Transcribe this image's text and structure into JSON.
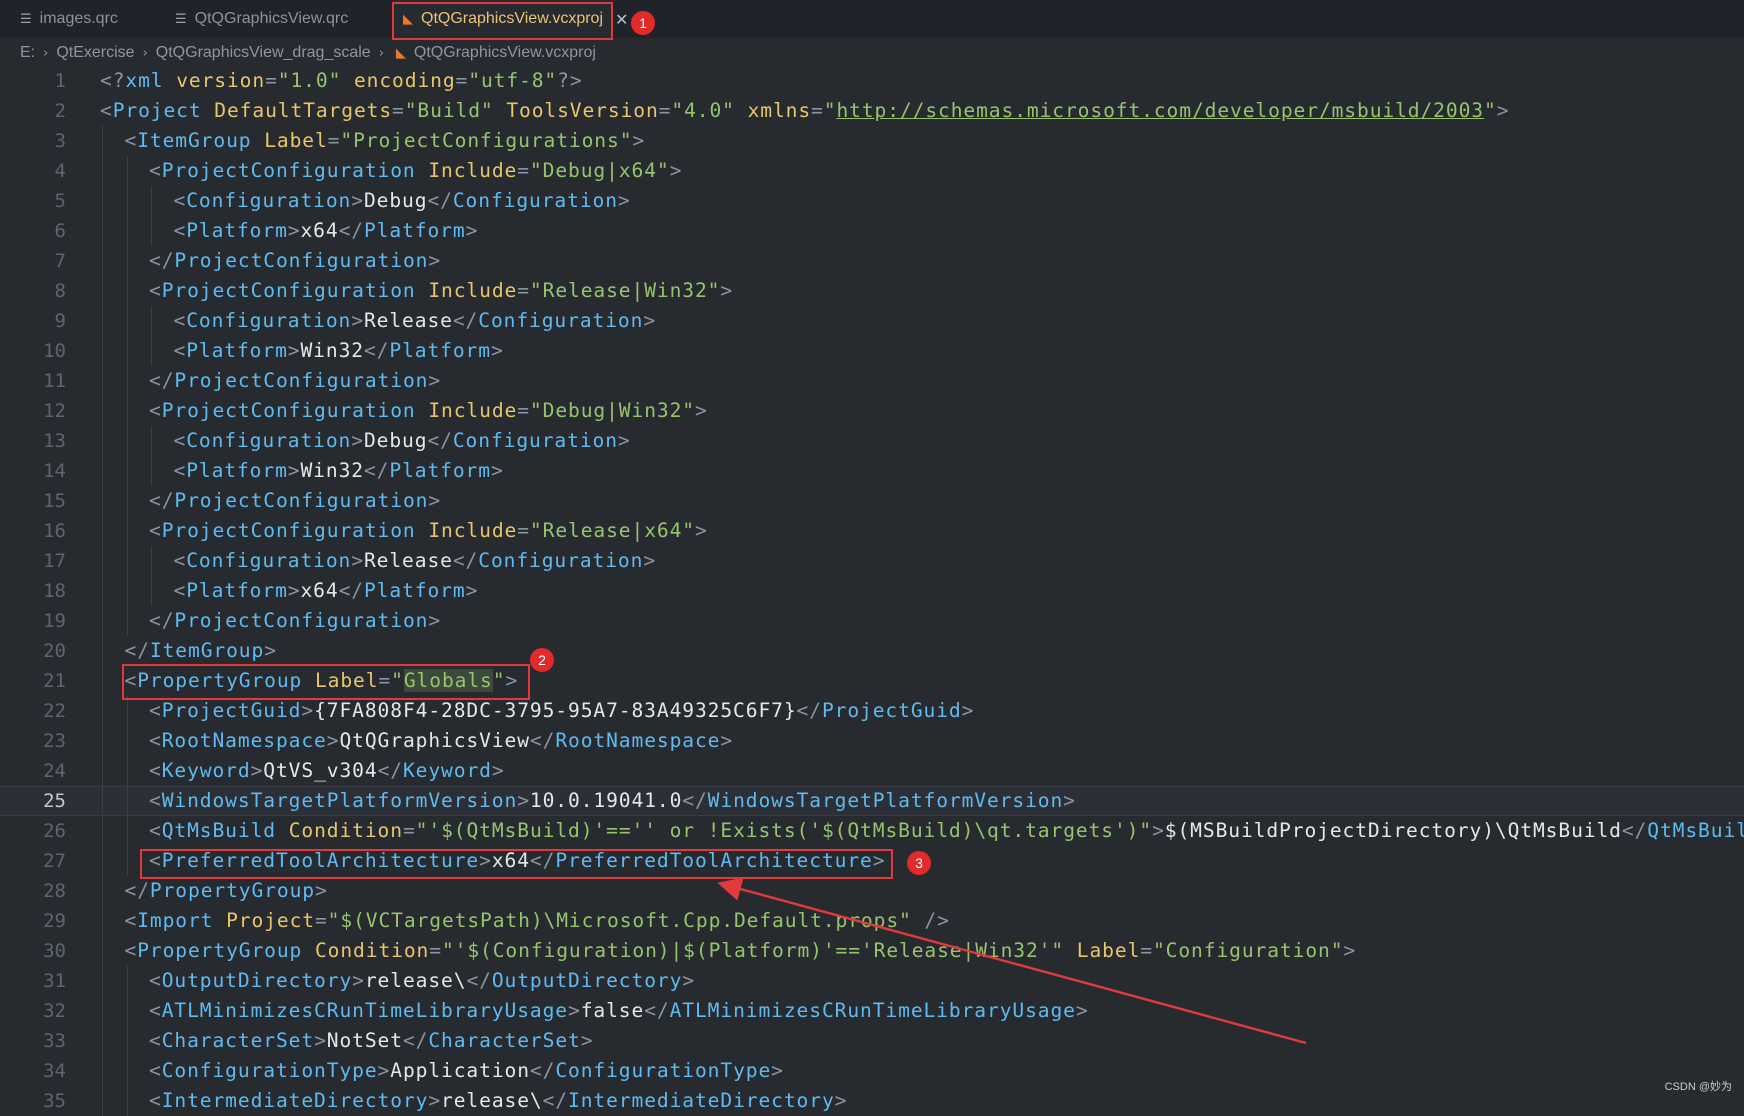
{
  "tabs": [
    {
      "label": "images.qrc",
      "icon": "file-lines-icon"
    },
    {
      "label": "QtQGraphicsView.qrc",
      "icon": "file-lines-icon"
    },
    {
      "label": "QtQGraphicsView.vcxproj",
      "icon": "rss-icon",
      "active": true
    }
  ],
  "breadcrumb": [
    "E:",
    "QtExercise",
    "QtQGraphicsView_drag_scale",
    "QtQGraphicsView.vcxproj"
  ],
  "current_line": 25,
  "lines": [
    {
      "n": "1",
      "indent": 0,
      "tokens": [
        [
          "p",
          "<?"
        ],
        [
          "tag",
          "xml"
        ],
        [
          "t",
          " "
        ],
        [
          "attr",
          "version"
        ],
        [
          "p",
          "="
        ],
        [
          "str",
          "\"1.0\""
        ],
        [
          "t",
          " "
        ],
        [
          "attr",
          "encoding"
        ],
        [
          "p",
          "="
        ],
        [
          "str",
          "\"utf-8\""
        ],
        [
          "p",
          "?>"
        ]
      ]
    },
    {
      "n": "2",
      "indent": 0,
      "tokens": [
        [
          "p",
          "<"
        ],
        [
          "tag",
          "Project"
        ],
        [
          "t",
          " "
        ],
        [
          "attr",
          "DefaultTargets"
        ],
        [
          "p",
          "="
        ],
        [
          "str",
          "\"Build\""
        ],
        [
          "t",
          " "
        ],
        [
          "attr",
          "ToolsVersion"
        ],
        [
          "p",
          "="
        ],
        [
          "str",
          "\"4.0\""
        ],
        [
          "t",
          " "
        ],
        [
          "attr",
          "xmlns"
        ],
        [
          "p",
          "="
        ],
        [
          "str",
          "\""
        ],
        [
          "url",
          "http://schemas.microsoft.com/developer/msbuild/2003"
        ],
        [
          "str",
          "\""
        ],
        [
          "p",
          ">"
        ]
      ]
    },
    {
      "n": "3",
      "indent": 1,
      "tokens": [
        [
          "p",
          "<"
        ],
        [
          "tag",
          "ItemGroup"
        ],
        [
          "t",
          " "
        ],
        [
          "attr",
          "Label"
        ],
        [
          "p",
          "="
        ],
        [
          "str",
          "\"ProjectConfigurations\""
        ],
        [
          "p",
          ">"
        ]
      ]
    },
    {
      "n": "4",
      "indent": 2,
      "tokens": [
        [
          "p",
          "<"
        ],
        [
          "tag",
          "ProjectConfiguration"
        ],
        [
          "t",
          " "
        ],
        [
          "attr",
          "Include"
        ],
        [
          "p",
          "="
        ],
        [
          "str",
          "\"Debug|x64\""
        ],
        [
          "p",
          ">"
        ]
      ]
    },
    {
      "n": "5",
      "indent": 3,
      "tokens": [
        [
          "p",
          "<"
        ],
        [
          "tag",
          "Configuration"
        ],
        [
          "p",
          ">"
        ],
        [
          "txt",
          "Debug"
        ],
        [
          "p",
          "</"
        ],
        [
          "tag",
          "Configuration"
        ],
        [
          "p",
          ">"
        ]
      ]
    },
    {
      "n": "6",
      "indent": 3,
      "tokens": [
        [
          "p",
          "<"
        ],
        [
          "tag",
          "Platform"
        ],
        [
          "p",
          ">"
        ],
        [
          "txt",
          "x64"
        ],
        [
          "p",
          "</"
        ],
        [
          "tag",
          "Platform"
        ],
        [
          "p",
          ">"
        ]
      ]
    },
    {
      "n": "7",
      "indent": 2,
      "tokens": [
        [
          "p",
          "</"
        ],
        [
          "tag",
          "ProjectConfiguration"
        ],
        [
          "p",
          ">"
        ]
      ]
    },
    {
      "n": "8",
      "indent": 2,
      "tokens": [
        [
          "p",
          "<"
        ],
        [
          "tag",
          "ProjectConfiguration"
        ],
        [
          "t",
          " "
        ],
        [
          "attr",
          "Include"
        ],
        [
          "p",
          "="
        ],
        [
          "str",
          "\"Release|Win32\""
        ],
        [
          "p",
          ">"
        ]
      ]
    },
    {
      "n": "9",
      "indent": 3,
      "tokens": [
        [
          "p",
          "<"
        ],
        [
          "tag",
          "Configuration"
        ],
        [
          "p",
          ">"
        ],
        [
          "txt",
          "Release"
        ],
        [
          "p",
          "</"
        ],
        [
          "tag",
          "Configuration"
        ],
        [
          "p",
          ">"
        ]
      ]
    },
    {
      "n": "10",
      "indent": 3,
      "tokens": [
        [
          "p",
          "<"
        ],
        [
          "tag",
          "Platform"
        ],
        [
          "p",
          ">"
        ],
        [
          "txt",
          "Win32"
        ],
        [
          "p",
          "</"
        ],
        [
          "tag",
          "Platform"
        ],
        [
          "p",
          ">"
        ]
      ]
    },
    {
      "n": "11",
      "indent": 2,
      "tokens": [
        [
          "p",
          "</"
        ],
        [
          "tag",
          "ProjectConfiguration"
        ],
        [
          "p",
          ">"
        ]
      ]
    },
    {
      "n": "12",
      "indent": 2,
      "tokens": [
        [
          "p",
          "<"
        ],
        [
          "tag",
          "ProjectConfiguration"
        ],
        [
          "t",
          " "
        ],
        [
          "attr",
          "Include"
        ],
        [
          "p",
          "="
        ],
        [
          "str",
          "\"Debug|Win32\""
        ],
        [
          "p",
          ">"
        ]
      ]
    },
    {
      "n": "13",
      "indent": 3,
      "tokens": [
        [
          "p",
          "<"
        ],
        [
          "tag",
          "Configuration"
        ],
        [
          "p",
          ">"
        ],
        [
          "txt",
          "Debug"
        ],
        [
          "p",
          "</"
        ],
        [
          "tag",
          "Configuration"
        ],
        [
          "p",
          ">"
        ]
      ]
    },
    {
      "n": "14",
      "indent": 3,
      "tokens": [
        [
          "p",
          "<"
        ],
        [
          "tag",
          "Platform"
        ],
        [
          "p",
          ">"
        ],
        [
          "txt",
          "Win32"
        ],
        [
          "p",
          "</"
        ],
        [
          "tag",
          "Platform"
        ],
        [
          "p",
          ">"
        ]
      ]
    },
    {
      "n": "15",
      "indent": 2,
      "tokens": [
        [
          "p",
          "</"
        ],
        [
          "tag",
          "ProjectConfiguration"
        ],
        [
          "p",
          ">"
        ]
      ]
    },
    {
      "n": "16",
      "indent": 2,
      "tokens": [
        [
          "p",
          "<"
        ],
        [
          "tag",
          "ProjectConfiguration"
        ],
        [
          "t",
          " "
        ],
        [
          "attr",
          "Include"
        ],
        [
          "p",
          "="
        ],
        [
          "str",
          "\"Release|x64\""
        ],
        [
          "p",
          ">"
        ]
      ]
    },
    {
      "n": "17",
      "indent": 3,
      "tokens": [
        [
          "p",
          "<"
        ],
        [
          "tag",
          "Configuration"
        ],
        [
          "p",
          ">"
        ],
        [
          "txt",
          "Release"
        ],
        [
          "p",
          "</"
        ],
        [
          "tag",
          "Configuration"
        ],
        [
          "p",
          ">"
        ]
      ]
    },
    {
      "n": "18",
      "indent": 3,
      "tokens": [
        [
          "p",
          "<"
        ],
        [
          "tag",
          "Platform"
        ],
        [
          "p",
          ">"
        ],
        [
          "txt",
          "x64"
        ],
        [
          "p",
          "</"
        ],
        [
          "tag",
          "Platform"
        ],
        [
          "p",
          ">"
        ]
      ]
    },
    {
      "n": "19",
      "indent": 2,
      "tokens": [
        [
          "p",
          "</"
        ],
        [
          "tag",
          "ProjectConfiguration"
        ],
        [
          "p",
          ">"
        ]
      ]
    },
    {
      "n": "20",
      "indent": 1,
      "tokens": [
        [
          "p",
          "</"
        ],
        [
          "tag",
          "ItemGroup"
        ],
        [
          "p",
          ">"
        ]
      ]
    },
    {
      "n": "21",
      "indent": 1,
      "tokens": [
        [
          "p",
          "<"
        ],
        [
          "tag",
          "PropertyGroup"
        ],
        [
          "t",
          " "
        ],
        [
          "attr",
          "Label"
        ],
        [
          "p",
          "="
        ],
        [
          "str",
          "\""
        ],
        [
          "strh",
          "Globals"
        ],
        [
          "str",
          "\""
        ],
        [
          "p",
          ">"
        ]
      ]
    },
    {
      "n": "22",
      "indent": 2,
      "tokens": [
        [
          "p",
          "<"
        ],
        [
          "tag",
          "ProjectGuid"
        ],
        [
          "p",
          ">"
        ],
        [
          "txt",
          "{7FA808F4-28DC-3795-95A7-83A49325C6F7}"
        ],
        [
          "p",
          "</"
        ],
        [
          "tag",
          "ProjectGuid"
        ],
        [
          "p",
          ">"
        ]
      ]
    },
    {
      "n": "23",
      "indent": 2,
      "tokens": [
        [
          "p",
          "<"
        ],
        [
          "tag",
          "RootNamespace"
        ],
        [
          "p",
          ">"
        ],
        [
          "txt",
          "QtQGraphicsView"
        ],
        [
          "p",
          "</"
        ],
        [
          "tag",
          "RootNamespace"
        ],
        [
          "p",
          ">"
        ]
      ]
    },
    {
      "n": "24",
      "indent": 2,
      "tokens": [
        [
          "p",
          "<"
        ],
        [
          "tag",
          "Keyword"
        ],
        [
          "p",
          ">"
        ],
        [
          "txt",
          "QtVS_v304"
        ],
        [
          "p",
          "</"
        ],
        [
          "tag",
          "Keyword"
        ],
        [
          "p",
          ">"
        ]
      ]
    },
    {
      "n": "25",
      "indent": 2,
      "tokens": [
        [
          "p",
          "<"
        ],
        [
          "tag",
          "WindowsTargetPlatformVersion"
        ],
        [
          "p",
          ">"
        ],
        [
          "txt",
          "10.0.19041.0"
        ],
        [
          "p",
          "</"
        ],
        [
          "tag",
          "WindowsTargetPlatformVersion"
        ],
        [
          "p",
          ">"
        ]
      ]
    },
    {
      "n": "26",
      "indent": 2,
      "tokens": [
        [
          "p",
          "<"
        ],
        [
          "tag",
          "QtMsBuild"
        ],
        [
          "t",
          " "
        ],
        [
          "attr",
          "Condition"
        ],
        [
          "p",
          "="
        ],
        [
          "str",
          "\"'$(QtMsBuild)'=='' or !Exists('$(QtMsBuild)\\qt.targets')\""
        ],
        [
          "p",
          ">"
        ],
        [
          "txt",
          "$(MSBuildProjectDirectory)\\QtMsBuild"
        ],
        [
          "p",
          "</"
        ],
        [
          "tag",
          "QtMsBuild"
        ],
        [
          "p",
          ">"
        ]
      ]
    },
    {
      "n": "27",
      "indent": 2,
      "tokens": [
        [
          "p",
          "<"
        ],
        [
          "tag",
          "PreferredToolArchitecture"
        ],
        [
          "p",
          ">"
        ],
        [
          "txt",
          "x64"
        ],
        [
          "p",
          "</"
        ],
        [
          "tag",
          "PreferredToolArchitecture"
        ],
        [
          "p",
          ">"
        ]
      ]
    },
    {
      "n": "28",
      "indent": 1,
      "tokens": [
        [
          "p",
          "</"
        ],
        [
          "tag",
          "PropertyGroup"
        ],
        [
          "p",
          ">"
        ]
      ]
    },
    {
      "n": "29",
      "indent": 1,
      "tokens": [
        [
          "p",
          "<"
        ],
        [
          "tag",
          "Import"
        ],
        [
          "t",
          " "
        ],
        [
          "attr",
          "Project"
        ],
        [
          "p",
          "="
        ],
        [
          "str",
          "\"$(VCTargetsPath)\\Microsoft.Cpp.Default.props\""
        ],
        [
          "t",
          " "
        ],
        [
          "p",
          "/>"
        ]
      ]
    },
    {
      "n": "30",
      "indent": 1,
      "tokens": [
        [
          "p",
          "<"
        ],
        [
          "tag",
          "PropertyGroup"
        ],
        [
          "t",
          " "
        ],
        [
          "attr",
          "Condition"
        ],
        [
          "p",
          "="
        ],
        [
          "str",
          "\"'$(Configuration)|$(Platform)'=='Release|Win32'\""
        ],
        [
          "t",
          " "
        ],
        [
          "attr",
          "Label"
        ],
        [
          "p",
          "="
        ],
        [
          "str",
          "\"Configuration\""
        ],
        [
          "p",
          ">"
        ]
      ]
    },
    {
      "n": "31",
      "indent": 2,
      "tokens": [
        [
          "p",
          "<"
        ],
        [
          "tag",
          "OutputDirectory"
        ],
        [
          "p",
          ">"
        ],
        [
          "txt",
          "release\\"
        ],
        [
          "p",
          "</"
        ],
        [
          "tag",
          "OutputDirectory"
        ],
        [
          "p",
          ">"
        ]
      ]
    },
    {
      "n": "32",
      "indent": 2,
      "tokens": [
        [
          "p",
          "<"
        ],
        [
          "tag",
          "ATLMinimizesCRunTimeLibraryUsage"
        ],
        [
          "p",
          ">"
        ],
        [
          "txt",
          "false"
        ],
        [
          "p",
          "</"
        ],
        [
          "tag",
          "ATLMinimizesCRunTimeLibraryUsage"
        ],
        [
          "p",
          ">"
        ]
      ]
    },
    {
      "n": "33",
      "indent": 2,
      "tokens": [
        [
          "p",
          "<"
        ],
        [
          "tag",
          "CharacterSet"
        ],
        [
          "p",
          ">"
        ],
        [
          "txt",
          "NotSet"
        ],
        [
          "p",
          "</"
        ],
        [
          "tag",
          "CharacterSet"
        ],
        [
          "p",
          ">"
        ]
      ]
    },
    {
      "n": "34",
      "indent": 2,
      "tokens": [
        [
          "p",
          "<"
        ],
        [
          "tag",
          "ConfigurationType"
        ],
        [
          "p",
          ">"
        ],
        [
          "txt",
          "Application"
        ],
        [
          "p",
          "</"
        ],
        [
          "tag",
          "ConfigurationType"
        ],
        [
          "p",
          ">"
        ]
      ]
    },
    {
      "n": "35",
      "indent": 2,
      "tokens": [
        [
          "p",
          "<"
        ],
        [
          "tag",
          "IntermediateDirectory"
        ],
        [
          "p",
          ">"
        ],
        [
          "txt",
          "release\\"
        ],
        [
          "p",
          "</"
        ],
        [
          "tag",
          "IntermediateDirectory"
        ],
        [
          "p",
          ">"
        ]
      ]
    }
  ],
  "annotations": {
    "badges": [
      "1",
      "2",
      "3"
    ],
    "color": "#e23a3a"
  },
  "watermark": "CSDN @妙为"
}
